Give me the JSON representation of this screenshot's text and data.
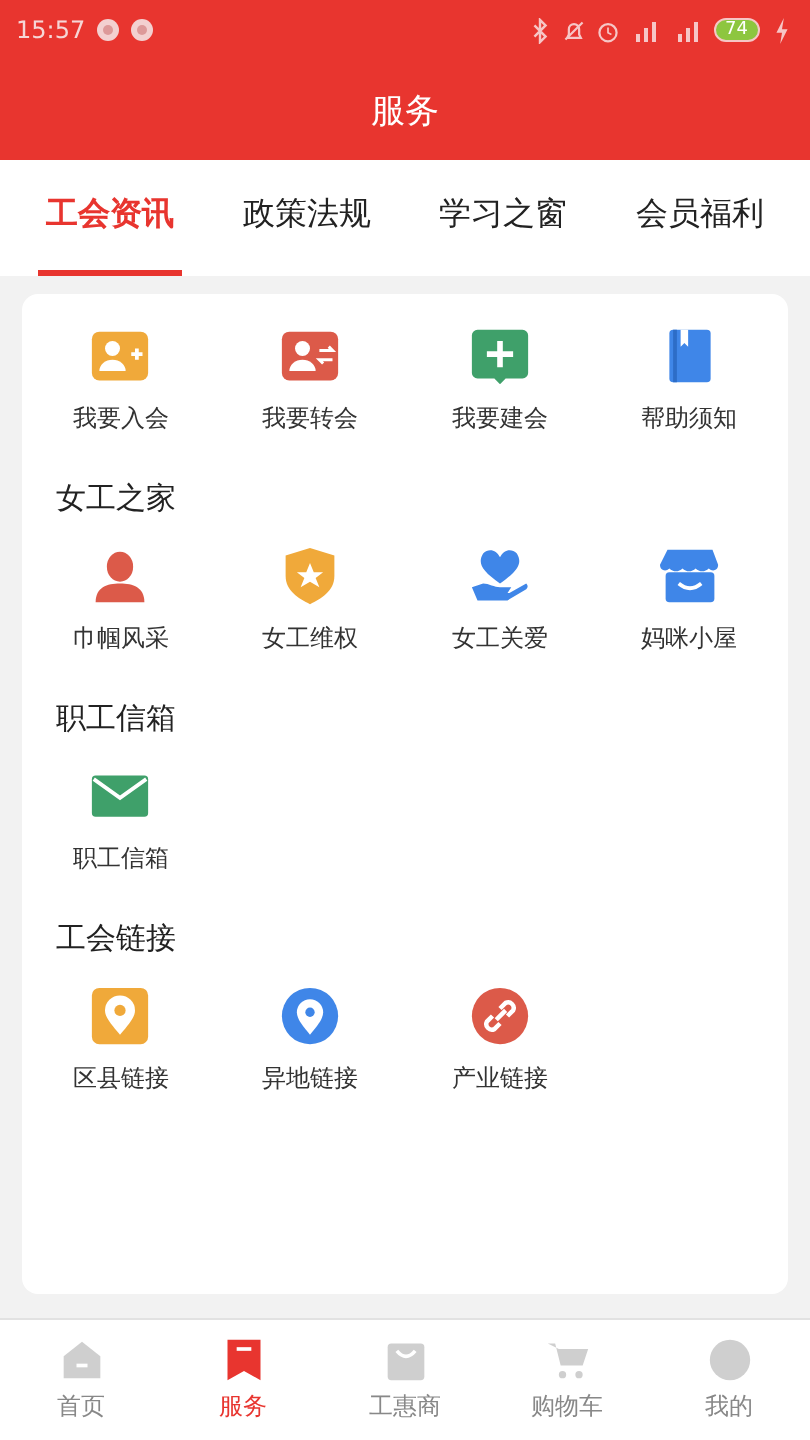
{
  "status_bar": {
    "time": "15:57",
    "battery": "74"
  },
  "header": {
    "title": "服务"
  },
  "tabs": [
    {
      "label": "工会资讯",
      "selected": true
    },
    {
      "label": "政策法规",
      "selected": false
    },
    {
      "label": "学习之窗",
      "selected": false
    },
    {
      "label": "会员福利",
      "selected": false
    }
  ],
  "sections": [
    {
      "items": [
        {
          "label": "我要入会",
          "kind": "join"
        },
        {
          "label": "我要转会",
          "kind": "transfer"
        },
        {
          "label": "我要建会",
          "kind": "create"
        },
        {
          "label": "帮助须知",
          "kind": "book"
        }
      ]
    },
    {
      "title": "女工之家",
      "items": [
        {
          "label": "巾帼风采",
          "kind": "person"
        },
        {
          "label": "女工维权",
          "kind": "shield"
        },
        {
          "label": "女工关爱",
          "kind": "heart"
        },
        {
          "label": "妈咪小屋",
          "kind": "shop"
        }
      ]
    },
    {
      "title": "职工信箱",
      "items": [
        {
          "label": "职工信箱",
          "kind": "mail"
        }
      ]
    },
    {
      "title": "工会链接",
      "items": [
        {
          "label": "区县链接",
          "kind": "pin"
        },
        {
          "label": "异地链接",
          "kind": "pin2"
        },
        {
          "label": "产业链接",
          "kind": "link"
        }
      ]
    }
  ],
  "bottom_nav": [
    {
      "label": "首页",
      "kind": "home",
      "selected": false
    },
    {
      "label": "服务",
      "kind": "service",
      "selected": true
    },
    {
      "label": "工惠商",
      "kind": "mall",
      "selected": false
    },
    {
      "label": "购物车",
      "kind": "cart",
      "selected": false
    },
    {
      "label": "我的",
      "kind": "user",
      "selected": false
    }
  ]
}
